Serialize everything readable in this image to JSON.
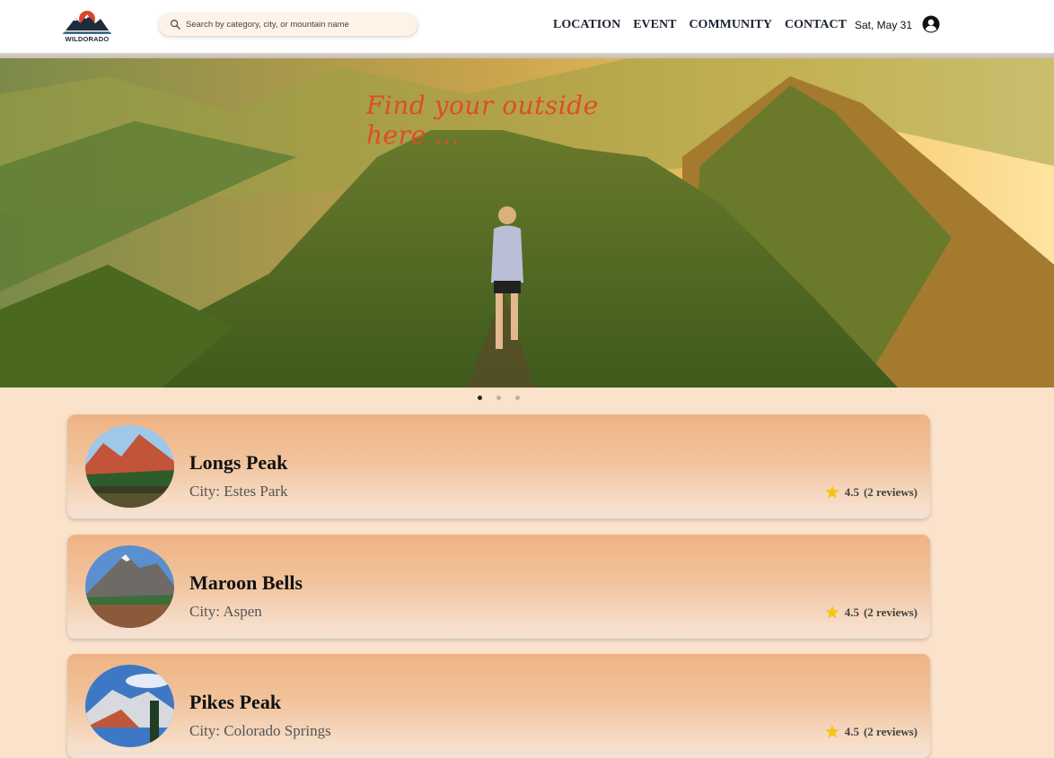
{
  "brand": {
    "logo_text": "WILDORADO"
  },
  "search": {
    "placeholder": "Search by category, city, or mountain name",
    "value": ""
  },
  "nav": {
    "links": [
      "LOCATION",
      "EVENT",
      "COMMUNITY",
      "CONTACT"
    ],
    "date": "Sat, May 31",
    "user_icon": "user-circle-icon"
  },
  "hero": {
    "tagline": "Find your outside here ...",
    "carousel": {
      "slides": 3,
      "active": 1
    }
  },
  "places": [
    {
      "name": "Longs Peak",
      "city": "City: Estes Park",
      "rating": "4.5",
      "reviews": "(2 reviews)"
    },
    {
      "name": "Maroon Bells",
      "city": "City: Aspen",
      "rating": "4.5",
      "reviews": "(2 reviews)"
    },
    {
      "name": "Pikes Peak",
      "city": "City: Colorado Springs",
      "rating": "4.5",
      "reviews": "(2 reviews)"
    }
  ],
  "colors": {
    "page_background": "#fae2cb",
    "tagline": "#e04b2a",
    "star": "#f5c518",
    "card_top": "#efb384"
  }
}
